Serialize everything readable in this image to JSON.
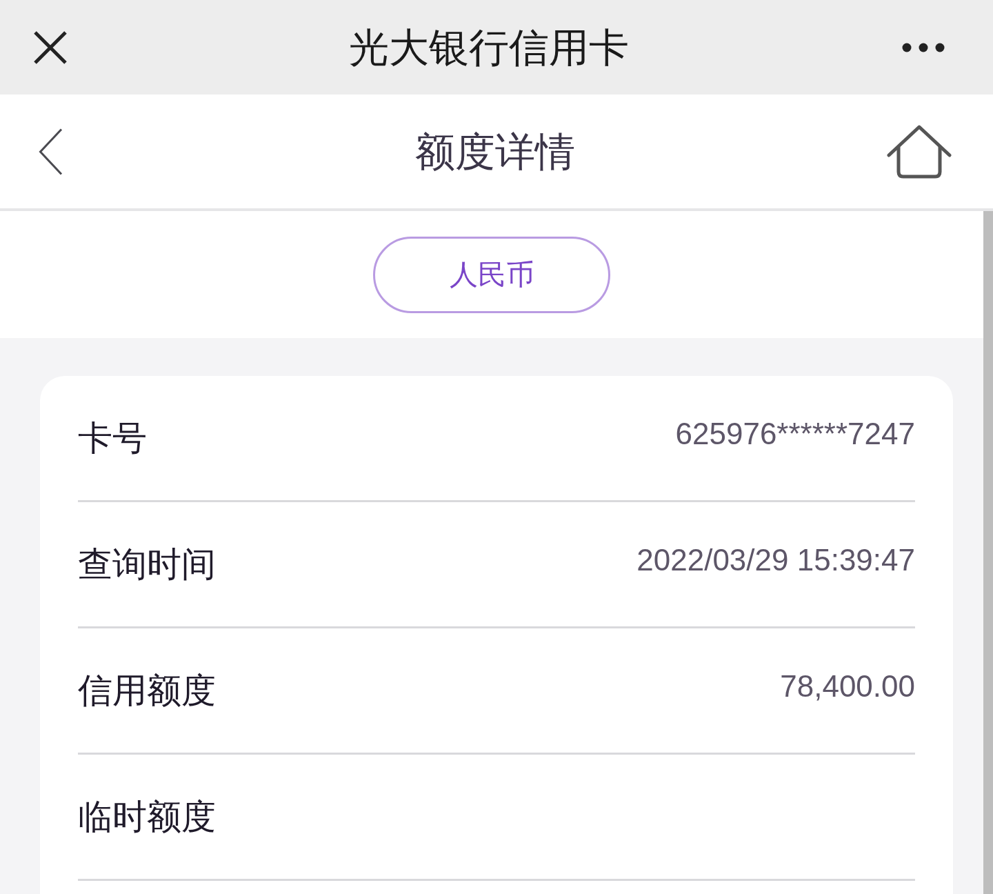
{
  "top_bar": {
    "title": "光大银行信用卡"
  },
  "header": {
    "title": "额度详情"
  },
  "currency_tabs": [
    {
      "label": "人民币",
      "selected": true
    }
  ],
  "details": [
    {
      "label": "卡号",
      "value": "625976******7247"
    },
    {
      "label": "查询时间",
      "value": "2022/03/29 15:39:47"
    },
    {
      "label": "信用额度",
      "value": "78,400.00"
    },
    {
      "label": "临时额度"
    }
  ]
}
